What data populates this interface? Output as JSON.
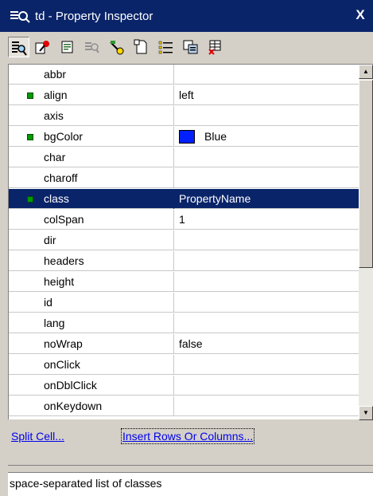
{
  "window": {
    "title": "td - Property Inspector",
    "close_label": "X"
  },
  "toolbar": {
    "buttons": [
      {
        "icon": "properties-view-icon",
        "pressed": true
      },
      {
        "icon": "event-icon",
        "pressed": false
      },
      {
        "icon": "css-style-icon",
        "pressed": false
      },
      {
        "icon": "search-disabled-icon",
        "pressed": false
      },
      {
        "icon": "behavior-icon",
        "pressed": false
      },
      {
        "icon": "new-document-icon",
        "pressed": false
      },
      {
        "icon": "list-icon",
        "pressed": false
      },
      {
        "icon": "copy-icon",
        "pressed": false
      },
      {
        "icon": "delete-table-icon",
        "pressed": false
      }
    ]
  },
  "properties": [
    {
      "name": "abbr",
      "value": "",
      "marker": false,
      "selected": false
    },
    {
      "name": "align",
      "value": "left",
      "marker": true,
      "selected": false
    },
    {
      "name": "axis",
      "value": "",
      "marker": false,
      "selected": false
    },
    {
      "name": "bgColor",
      "value": "Blue",
      "marker": true,
      "selected": false,
      "swatch": "#0020ff"
    },
    {
      "name": "char",
      "value": "",
      "marker": false,
      "selected": false
    },
    {
      "name": "charoff",
      "value": "",
      "marker": false,
      "selected": false
    },
    {
      "name": "class",
      "value": "PropertyName",
      "marker": true,
      "selected": true
    },
    {
      "name": "colSpan",
      "value": "1",
      "marker": false,
      "selected": false
    },
    {
      "name": "dir",
      "value": "",
      "marker": false,
      "selected": false
    },
    {
      "name": "headers",
      "value": "",
      "marker": false,
      "selected": false
    },
    {
      "name": "height",
      "value": "",
      "marker": false,
      "selected": false
    },
    {
      "name": "id",
      "value": "",
      "marker": false,
      "selected": false
    },
    {
      "name": "lang",
      "value": "",
      "marker": false,
      "selected": false
    },
    {
      "name": "noWrap",
      "value": "false",
      "marker": false,
      "selected": false
    },
    {
      "name": "onClick",
      "value": "",
      "marker": false,
      "selected": false
    },
    {
      "name": "onDblClick",
      "value": "",
      "marker": false,
      "selected": false
    },
    {
      "name": "onKeydown",
      "value": "",
      "marker": false,
      "selected": false
    }
  ],
  "links": {
    "split_cell": "Split Cell...",
    "insert_rows": "Insert Rows Or Columns..."
  },
  "status": {
    "text": "space-separated list of classes"
  },
  "colors": {
    "titlebar": "#0a246a",
    "selection": "#0a246a",
    "marker": "#009a00",
    "link": "#0000ee"
  }
}
